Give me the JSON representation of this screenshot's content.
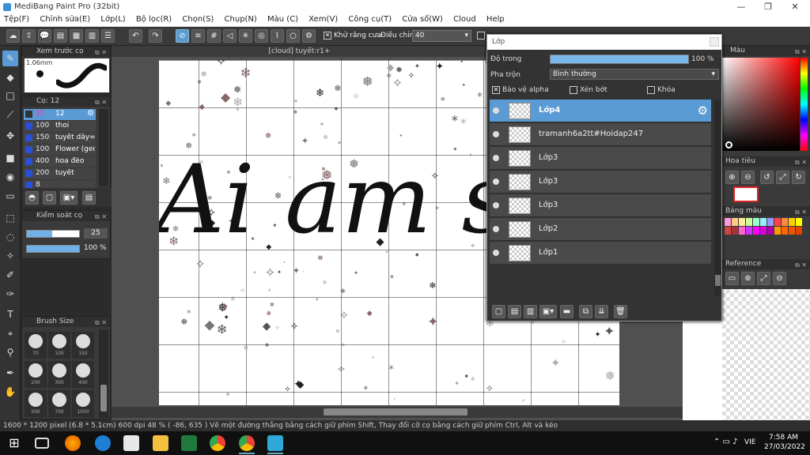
{
  "window": {
    "title": "MediBang Paint Pro (32bit)"
  },
  "menu": [
    "Tệp(F)",
    "Chỉnh sửa(E)",
    "Lớp(L)",
    "Bộ lọc(R)",
    "Chọn(S)",
    "Chụp(N)",
    "Màu (C)",
    "Xem(V)",
    "Công cụ(T)",
    "Cửa sổ(W)",
    "Cloud",
    "Help"
  ],
  "toolbar": {
    "antialias_label": "Khử răng cưa",
    "adjust_label": "Điều chỉnh",
    "adjust_value": "40"
  },
  "brush_preview": {
    "title": "Xem trước cọ",
    "size": "1.06mm"
  },
  "brush_list": {
    "title": "Cọ: 12",
    "items": [
      {
        "size": "25",
        "name": "12"
      },
      {
        "size": "100",
        "name": "thoi"
      },
      {
        "size": "150",
        "name": "tuyết dây=))"
      },
      {
        "size": "100",
        "name": "Flower (geom"
      },
      {
        "size": "400",
        "name": "hoa đèo"
      },
      {
        "size": "200",
        "name": "tuyết"
      },
      {
        "size": "8",
        "name": ""
      }
    ]
  },
  "brush_control": {
    "title": "Kiểm soát cọ",
    "size_value": "25",
    "opacity_value": "100 %"
  },
  "brush_size": {
    "title": "Brush Size",
    "sizes": [
      "70",
      "100",
      "150",
      "200",
      "300",
      "400",
      "500",
      "700",
      "1000"
    ]
  },
  "canvas": {
    "tab_title": "[cloud] tuyết:r1+",
    "lettering": "Ai am sá"
  },
  "layer_window": {
    "title": "Lớp",
    "opacity_label": "Độ trong",
    "opacity_value": "100 %",
    "opacity_fraction": 1.0,
    "blend_label": "Pha trộn",
    "blend_value": "Bình thường",
    "protect_alpha": "Bảo vệ alpha",
    "clipping": "Xén bớt",
    "lock": "Khóa",
    "layers": [
      {
        "name": "Lớp4",
        "selected": true
      },
      {
        "name": "tramanh6a2tt#Hoidap247",
        "selected": false
      },
      {
        "name": "Lớp3",
        "selected": false
      },
      {
        "name": "Lớp3",
        "selected": false
      },
      {
        "name": "Lớp3",
        "selected": false
      },
      {
        "name": "Lớp2",
        "selected": false
      },
      {
        "name": "Lớp1",
        "selected": false
      }
    ]
  },
  "right_panels": {
    "color_title": "Màu",
    "navigator_title": "Hoa tiêu",
    "palette_title": "Bảng màu",
    "reference_title": "Reference"
  },
  "status": {
    "text": "1600 * 1200 pixel   (6.8 * 5.1cm)   600 dpi   48 %   ( -86, 635 )   Vẽ một đường thẳng bằng cách giữ phím Shift, Thay đổi cỡ cọ bằng cách giữ phím Ctrl, Alt và kéo"
  },
  "taskbar": {
    "lang": "VIE",
    "time": "7:58 AM",
    "date": "27/03/2022"
  },
  "colors": {
    "accent": "#5b9bd5",
    "panel": "#3a3a3a"
  }
}
